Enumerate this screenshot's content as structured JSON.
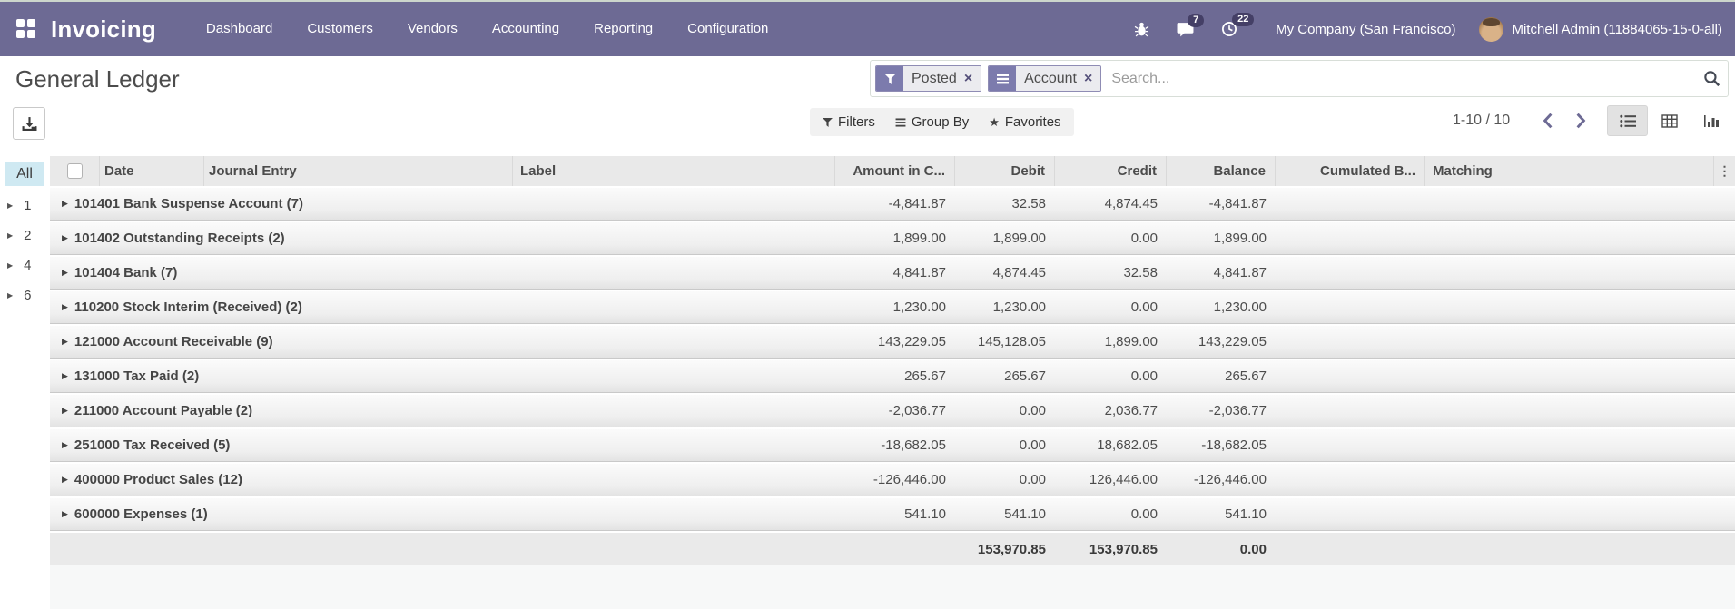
{
  "topbar": {
    "brand": "Invoicing",
    "menus": [
      "Dashboard",
      "Customers",
      "Vendors",
      "Accounting",
      "Reporting",
      "Configuration"
    ],
    "messages_badge": "7",
    "activities_badge": "22",
    "company": "My Company (San Francisco)",
    "user": "Mitchell Admin (11884065-15-0-all)"
  },
  "control_panel": {
    "title": "General Ledger",
    "search": {
      "facets": [
        {
          "icon": "filter-icon",
          "label": "Posted"
        },
        {
          "icon": "group-by-icon",
          "label": "Account"
        }
      ],
      "placeholder": "Search...",
      "remove_glyph": "×"
    },
    "filters_label": "Filters",
    "group_by_label": "Group By",
    "favorites_label": "Favorites",
    "favorites_star": "★",
    "pager_range": "1-10 / 10"
  },
  "level_sidebar": {
    "all_label": "All",
    "levels": [
      "1",
      "2",
      "4",
      "6"
    ],
    "caret": "▶"
  },
  "table": {
    "columns": [
      "Date",
      "Journal Entry",
      "Label",
      "Amount in C...",
      "Debit",
      "Credit",
      "Balance",
      "Cumulated B...",
      "Matching"
    ],
    "options_glyph": "⋮",
    "group_caret": "▶",
    "rows": [
      {
        "name": "101401 Bank Suspense Account (7)",
        "amount_currency": "-4,841.87",
        "debit": "32.58",
        "credit": "4,874.45",
        "balance": "-4,841.87"
      },
      {
        "name": "101402 Outstanding Receipts (2)",
        "amount_currency": "1,899.00",
        "debit": "1,899.00",
        "credit": "0.00",
        "balance": "1,899.00"
      },
      {
        "name": "101404 Bank (7)",
        "amount_currency": "4,841.87",
        "debit": "4,874.45",
        "credit": "32.58",
        "balance": "4,841.87"
      },
      {
        "name": "110200 Stock Interim (Received) (2)",
        "amount_currency": "1,230.00",
        "debit": "1,230.00",
        "credit": "0.00",
        "balance": "1,230.00"
      },
      {
        "name": "121000 Account Receivable (9)",
        "amount_currency": "143,229.05",
        "debit": "145,128.05",
        "credit": "1,899.00",
        "balance": "143,229.05"
      },
      {
        "name": "131000 Tax Paid (2)",
        "amount_currency": "265.67",
        "debit": "265.67",
        "credit": "0.00",
        "balance": "265.67"
      },
      {
        "name": "211000 Account Payable (2)",
        "amount_currency": "-2,036.77",
        "debit": "0.00",
        "credit": "2,036.77",
        "balance": "-2,036.77"
      },
      {
        "name": "251000 Tax Received (5)",
        "amount_currency": "-18,682.05",
        "debit": "0.00",
        "credit": "18,682.05",
        "balance": "-18,682.05"
      },
      {
        "name": "400000 Product Sales (12)",
        "amount_currency": "-126,446.00",
        "debit": "0.00",
        "credit": "126,446.00",
        "balance": "-126,446.00"
      },
      {
        "name": "600000 Expenses (1)",
        "amount_currency": "541.10",
        "debit": "541.10",
        "credit": "0.00",
        "balance": "541.10"
      }
    ],
    "total": {
      "debit": "153,970.85",
      "credit": "153,970.85",
      "balance": "0.00"
    }
  },
  "colors": {
    "navbar": "#6d6a94",
    "facet_icon_bg": "#7c7bad",
    "all_highlight": "#cfe9f2"
  }
}
